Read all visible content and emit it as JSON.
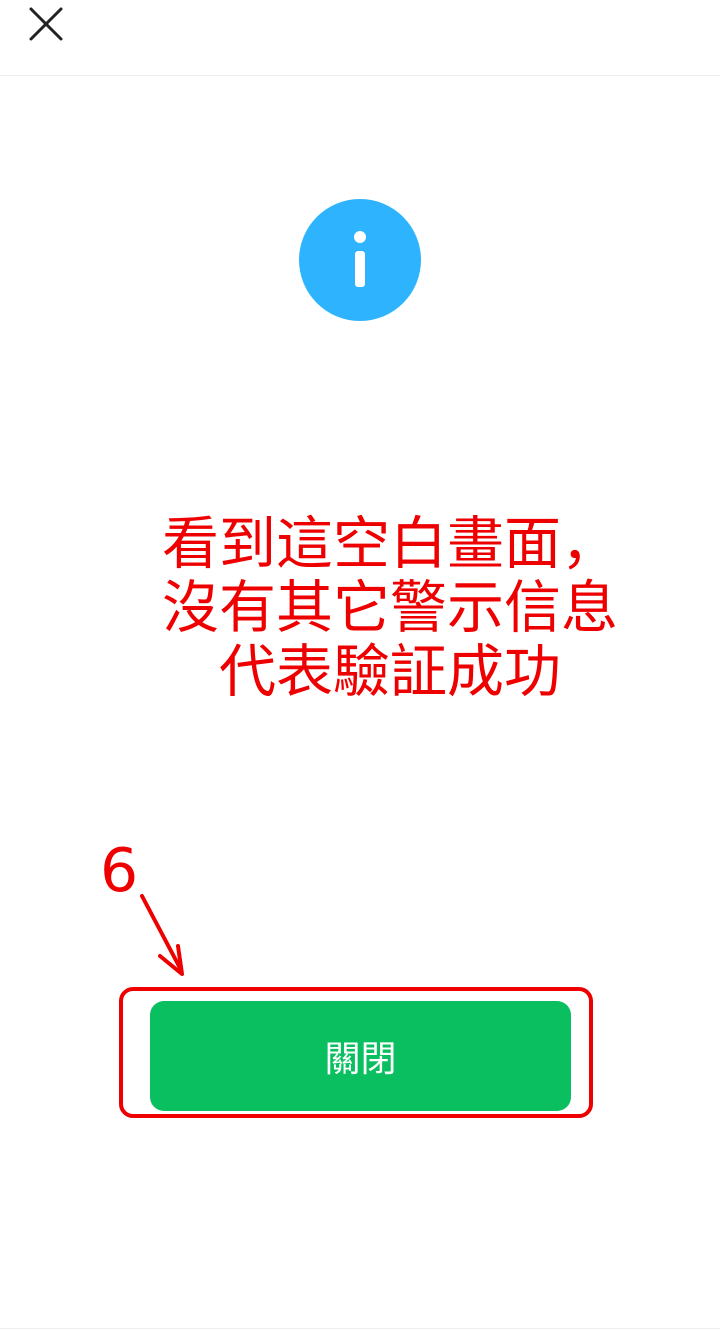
{
  "header": {
    "close_icon": "close-icon"
  },
  "status": {
    "icon": "info-icon",
    "icon_color": "#2eb4ff"
  },
  "annotation": {
    "lines": [
      "看到這空白畫面，",
      "沒有其它警示信息",
      "代表驗証成功"
    ],
    "step_number": "6",
    "color": "#ee0000"
  },
  "actions": {
    "close_label": "關閉",
    "close_color": "#0abf60"
  }
}
